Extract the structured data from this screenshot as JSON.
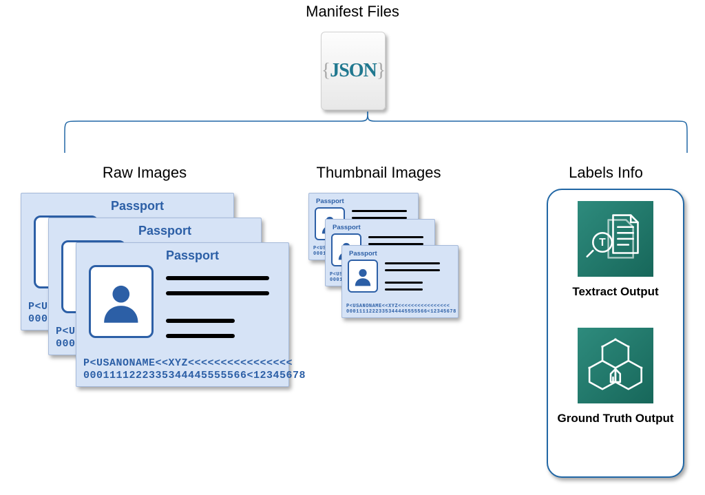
{
  "title": "Manifest Files",
  "json_icon": {
    "left": "{",
    "label": "JSON",
    "right": "}"
  },
  "sections": {
    "raw": "Raw Images",
    "thumb": "Thumbnail Images",
    "labels": "Labels Info"
  },
  "passport": {
    "label": "Passport",
    "mrz1": "P<USANONAME<<XYZ<<<<<<<<<<<<<<<<",
    "mrz2": "0001111222335344445555566<12345678"
  },
  "thumb_passport": {
    "label": "Passport",
    "mrz1": "P<USANONAME<<XYZ<<<<<<<<<<<<<<<<",
    "mrz2": "0001111222335344445555566<12345678"
  },
  "labels_panel": {
    "textract": "Textract Output",
    "groundtruth": "Ground Truth Output"
  }
}
